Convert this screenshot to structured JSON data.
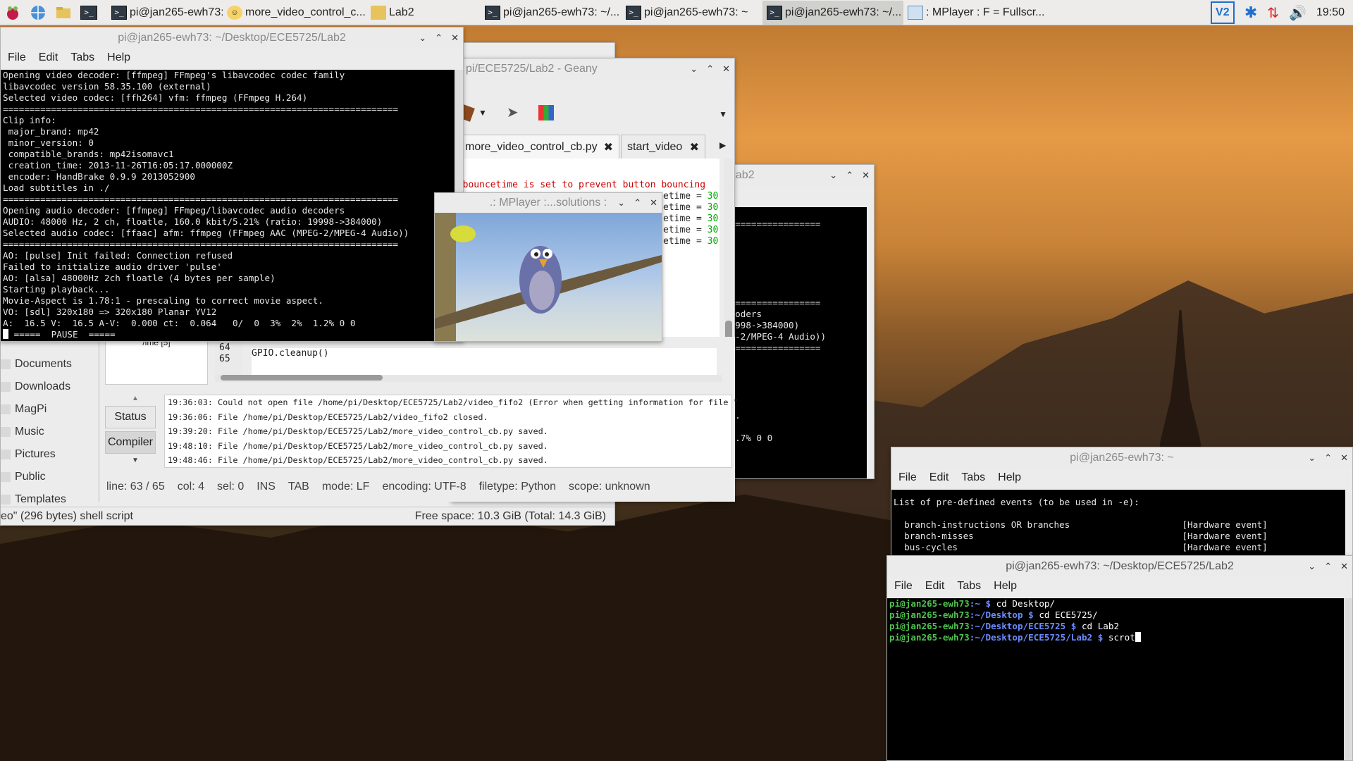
{
  "taskbar": {
    "tasks": [
      {
        "label": "pi@jan265-ewh73: ~/..."
      },
      {
        "label": "more_video_control_c..."
      },
      {
        "label": "Lab2"
      },
      {
        "label": "pi@jan265-ewh73: ~/..."
      },
      {
        "label": "pi@jan265-ewh73: ~"
      },
      {
        "label": "pi@jan265-ewh73: ~/..."
      },
      {
        "label": ": MPlayer : F = Fullscr..."
      }
    ],
    "clock": "19:50"
  },
  "term1": {
    "title": "pi@jan265-ewh73: ~/Desktop/ECE5725/Lab2",
    "menu": [
      "File",
      "Edit",
      "Tabs",
      "Help"
    ],
    "lines": [
      "Opening video decoder: [ffmpeg] FFmpeg's libavcodec codec family",
      "libavcodec version 58.35.100 (external)",
      "Selected video codec: [ffh264] vfm: ffmpeg (FFmpeg H.264)",
      "==========================================================================",
      "Clip info:",
      " major_brand: mp42",
      " minor_version: 0",
      " compatible_brands: mp42isomavc1",
      " creation_time: 2013-11-26T16:05:17.000000Z",
      " encoder: HandBrake 0.9.9 2013052900",
      "Load subtitles in ./",
      "==========================================================================",
      "Opening audio decoder: [ffmpeg] FFmpeg/libavcodec audio decoders",
      "AUDIO: 48000 Hz, 2 ch, floatle, 160.0 kbit/5.21% (ratio: 19998->384000)",
      "Selected audio codec: [ffaac] afm: ffmpeg (FFmpeg AAC (MPEG-2/MPEG-4 Audio))",
      "==========================================================================",
      "AO: [pulse] Init failed: Connection refused",
      "Failed to initialize audio driver 'pulse'",
      "AO: [alsa] 48000Hz 2ch floatle (4 bytes per sample)",
      "Starting playback...",
      "Movie-Aspect is 1.78:1 - prescaling to correct movie aspect.",
      "VO: [sdl] 320x180 => 320x180 Planar YV12",
      "A:  16.5 V:  16.5 A-V:  0.000 ct:  0.064   0/  0  3%  2%  1.2% 0 0"
    ],
    "pause_line": " =====  PAUSE  ====="
  },
  "filemanager": {
    "items": [
      "Documents",
      "Downloads",
      "MagPi",
      "Music",
      "Pictures",
      "Public",
      "Templates"
    ],
    "status_left": "eo\" (296 bytes) shell script",
    "status_right": "Free space: 10.3 GiB (Total: 14.3 GiB)"
  },
  "geany": {
    "title": "pi/ECE5725/Lab2 - Geany",
    "tabs": [
      "more_video_control_cb.py",
      "start_video"
    ],
    "code_comment": "l bouncetime is set to prevent button bouncing",
    "code_lines": [
      "etime = 30",
      "etime = 30",
      "etime = 30",
      "etime = 30",
      "etime = 30"
    ],
    "line_numbers": [
      "64",
      "65"
    ],
    "code_bottom": "GPIO.cleanup()",
    "sidebar_item": "/ime [5]",
    "side_buttons": [
      "Status",
      "Compiler"
    ],
    "messages": [
      "19:36:03: Could not open file /home/pi/Desktop/ECE5725/Lab2/video_fifo2 (Error when getting information for file \"",
      "19:36:06: File /home/pi/Desktop/ECE5725/Lab2/video_fifo2 closed.",
      "19:39:20: File /home/pi/Desktop/ECE5725/Lab2/more_video_control_cb.py saved.",
      "19:48:10: File /home/pi/Desktop/ECE5725/Lab2/more_video_control_cb.py saved.",
      "19:48:46: File /home/pi/Desktop/ECE5725/Lab2/more_video_control_cb.py saved."
    ],
    "status": [
      "line: 63 / 65",
      "col: 4",
      "sel: 0",
      "INS",
      "TAB",
      "mode: LF",
      "encoding: UTF-8",
      "filetype: Python",
      "scope: unknown"
    ]
  },
  "mplayer": {
    "title": ".: MPlayer :...solutions :"
  },
  "term_mid": {
    "title": "Lab2",
    "lines": [
      "",
      "==================",
      "",
      "",
      "",
      "",
      "",
      "",
      "==================",
      "ecoders",
      "19998->384000)",
      "EG-2/MPEG-4 Audio))",
      "==================",
      "",
      "",
      "",
      "",
      "",
      "ct.",
      "",
      " 1.7% 0 0"
    ]
  },
  "term_perf": {
    "title": "pi@jan265-ewh73: ~",
    "menu": [
      "File",
      "Edit",
      "Tabs",
      "Help"
    ],
    "lines": [
      "List of pre-defined events (to be used in -e):",
      "",
      "  branch-instructions OR branches                     [Hardware event]",
      "  branch-misses                                       [Hardware event]",
      "  bus-cycles                                          [Hardware event]"
    ]
  },
  "term_front": {
    "title": "pi@jan265-ewh73: ~/Desktop/ECE5725/Lab2",
    "menu": [
      "File",
      "Edit",
      "Tabs",
      "Help"
    ],
    "prompt_user": "pi@jan265-ewh73",
    "rows": [
      {
        "path": ":~ $ ",
        "cmd": "cd Desktop/"
      },
      {
        "path": ":~/Desktop $ ",
        "cmd": "cd ECE5725/"
      },
      {
        "path": ":~/Desktop/ECE5725 $ ",
        "cmd": "cd Lab2"
      },
      {
        "path": ":~/Desktop/ECE5725/Lab2 $ ",
        "cmd": "scrot"
      }
    ]
  }
}
